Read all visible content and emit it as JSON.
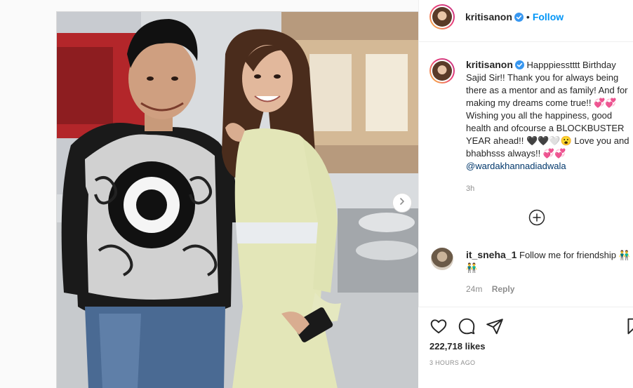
{
  "header": {
    "username": "kritisanon",
    "follow_label": "Follow",
    "separator": "•"
  },
  "caption": {
    "username": "kritisanon",
    "text": "Happpiesstttt Birthday Sajid Sir!! Thank you for always being there as a mentor and as family! And for making my dreams come true!! 💞💞 Wishing you all the happiness, good health and ofcourse a BLOCKBUSTER YEAR ahead!! 🖤🖤🤍😮 Love you and bhabhsss always!! 💞💞",
    "mention": "@wardakhannadiadwala",
    "time": "3h"
  },
  "comments": [
    {
      "username": "it_sneha_1",
      "text": "Follow me for friendship 👬👬",
      "time": "24m",
      "reply_label": "Reply"
    }
  ],
  "actions": {
    "likes": "222,718 likes",
    "posted_ago": "3 HOURS AGO"
  },
  "icons": {
    "verified": "verified-badge-icon",
    "like": "heart-icon",
    "comment": "comment-bubble-icon",
    "share": "paper-plane-icon",
    "save": "bookmark-icon",
    "load_more": "plus-circle-icon",
    "next": "chevron-right-icon"
  },
  "colors": {
    "link_blue": "#0095f6",
    "verified_blue": "#3897f0",
    "mention_blue": "#00376b",
    "muted": "#8e8e8e"
  }
}
